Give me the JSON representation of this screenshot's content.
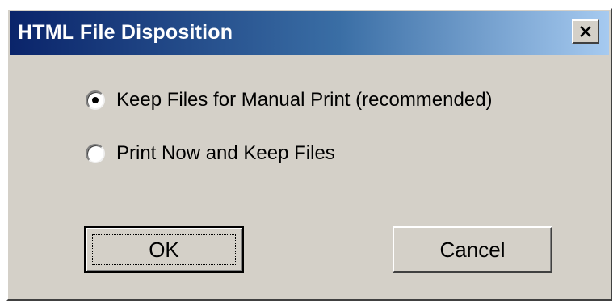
{
  "window": {
    "title": "HTML File Disposition",
    "close_icon": "close-x-icon"
  },
  "options": [
    {
      "label": "Keep Files for Manual Print (recommended)",
      "selected": true
    },
    {
      "label": "Print Now and Keep Files",
      "selected": false
    }
  ],
  "buttons": {
    "ok_label": "OK",
    "cancel_label": "Cancel"
  },
  "colors": {
    "face": "#d4d0c8",
    "title_start": "#0a246a",
    "title_end": "#a6caf0"
  }
}
